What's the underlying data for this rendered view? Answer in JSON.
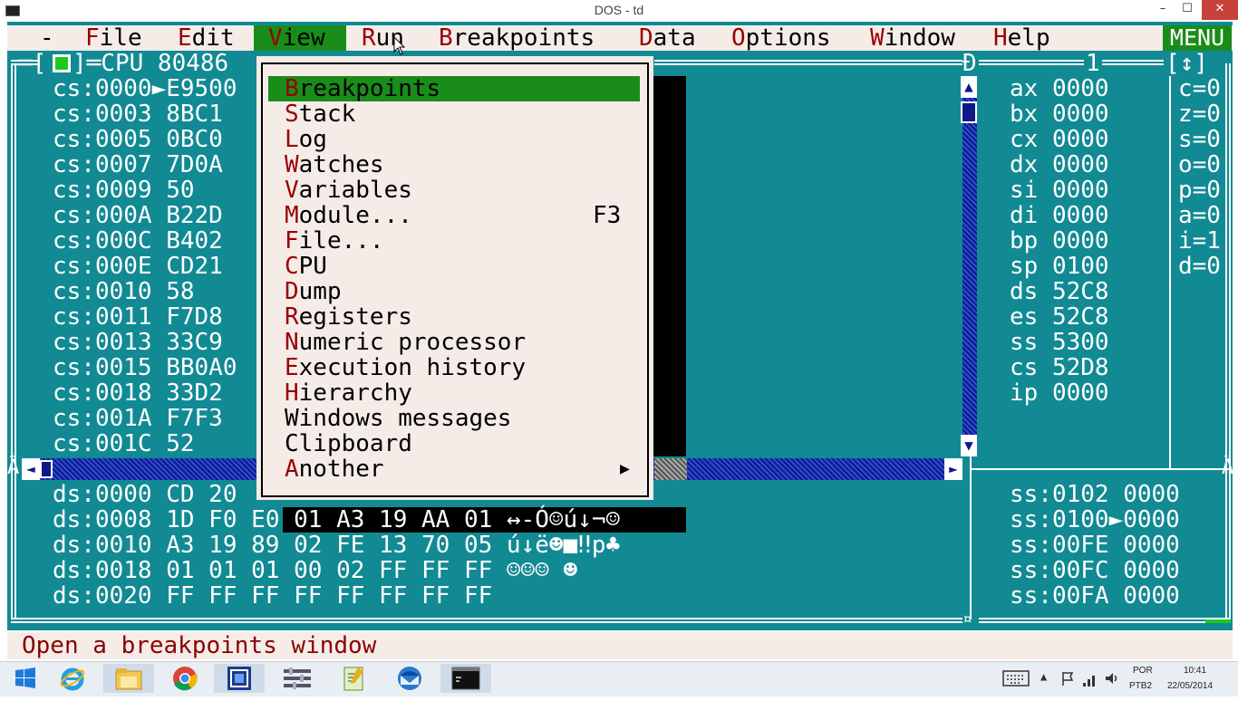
{
  "titlebar": {
    "title": "DOS - td",
    "minimize": "–",
    "maximize": "☐",
    "close": "✕"
  },
  "menubar": {
    "dash": "-",
    "file": {
      "hot": "F",
      "rest": "ile"
    },
    "edit": {
      "hot": "E",
      "rest": "dit"
    },
    "view": {
      "hot": "V",
      "rest": "iew"
    },
    "run": {
      "hot": "R",
      "rest": "un"
    },
    "breakpoints": {
      "hot": "B",
      "rest": "reakpoints"
    },
    "data": {
      "hot": "D",
      "rest": "ata"
    },
    "options": {
      "hot": "O",
      "rest": "ptions"
    },
    "window": {
      "hot": "W",
      "rest": "indow"
    },
    "help": {
      "hot": "H",
      "rest": "elp"
    },
    "menu_button": "MENU"
  },
  "cpu_window": {
    "title_left": "═[",
    "title_box": "■",
    "title_right": "]═CPU 80486",
    "corner_right": "Đ",
    "window_number": "1",
    "resize_box": "[↕]",
    "code_lines": [
      "cs:0000►E9500",
      "cs:0003 8BC1",
      "cs:0005 0BC0",
      "cs:0007 7D0A",
      "cs:0009 50",
      "cs:000A B22D",
      "cs:000C B402",
      "cs:000E CD21",
      "cs:0010 58",
      "cs:0011 F7D8",
      "cs:0013 33C9",
      "cs:0015 BB0A0",
      "cs:0018 33D2",
      "cs:001A F7F3",
      "cs:001C 52"
    ],
    "registers": [
      "ax 0000",
      "bx 0000",
      "cx 0000",
      "dx 0000",
      "si 0000",
      "di 0000",
      "bp 0000",
      "sp 0100",
      "ds 52C8",
      "es 52C8",
      "ss 5300",
      "cs 52D8",
      "ip 0000"
    ],
    "flags": [
      "c=0",
      "z=0",
      "s=0",
      "o=0",
      "p=0",
      "a=0",
      "i=1",
      "d=0"
    ],
    "dump_lines": [
      {
        "left": "ds:0000 CD 20",
        "right": ""
      },
      {
        "left": "ds:0008 1D F0 E",
        "black": "0 01 A3 19 AA 01 ↔-Ó☺ú↓¬☺"
      },
      {
        "left": "ds:0010 A3 19 89 02 FE 13 70 05 ú↓ë☻■‼p♣",
        "black": ""
      },
      {
        "left": "ds:0018 01 01 01 00 02 FF FF FF ☺☺☺ ☻",
        "black": ""
      },
      {
        "left": "ds:0020 FF FF FF FF FF FF FF FF",
        "black": ""
      }
    ],
    "stack_lines": [
      "ss:0102 0000",
      "ss:0100►0000",
      "ss:00FE 0000",
      "ss:00FC 0000",
      "ss:00FA 0000"
    ],
    "scroll_up": "▲",
    "scroll_down": "▼",
    "scroll_left": "◄",
    "scroll_right": "►",
    "edge_left": "Ã",
    "edge_right": "Ä",
    "bottom_corner": "¤"
  },
  "view_menu": {
    "items": [
      {
        "hot": "B",
        "rest": "reakpoints",
        "shortcut": ""
      },
      {
        "hot": "S",
        "rest": "tack",
        "shortcut": ""
      },
      {
        "hot": "L",
        "rest": "og",
        "shortcut": ""
      },
      {
        "hot": "W",
        "rest": "atches",
        "shortcut": ""
      },
      {
        "hot": "V",
        "rest": "ariables",
        "shortcut": ""
      },
      {
        "hot": "M",
        "rest": "odule...",
        "shortcut": "F3"
      },
      {
        "hot": "F",
        "rest": "ile...",
        "shortcut": ""
      },
      {
        "hot": "C",
        "rest": "PU",
        "shortcut": ""
      },
      {
        "hot": "D",
        "rest": "ump",
        "shortcut": ""
      },
      {
        "hot": "R",
        "rest": "egisters",
        "shortcut": ""
      },
      {
        "hot": "N",
        "rest": "umeric processor",
        "shortcut": ""
      },
      {
        "hot": "E",
        "rest": "xecution history",
        "shortcut": ""
      },
      {
        "hot": "H",
        "rest": "ierarchy",
        "shortcut": ""
      },
      {
        "hot": "",
        "rest": "Windows messages",
        "shortcut": ""
      },
      {
        "hot": "",
        "rest": "Clipboard",
        "shortcut": ""
      },
      {
        "hot": "A",
        "rest": "nother",
        "shortcut": "▶"
      }
    ]
  },
  "status": {
    "text": "Open a breakpoints window"
  },
  "taskbar": {
    "apps": [
      "start-icon",
      "ie-icon",
      "explorer-icon",
      "chrome-icon",
      "app-icon",
      "tools-icon",
      "notepad-icon",
      "thunderbird-icon",
      "cmd-icon"
    ],
    "lang": "POR",
    "layout": "PTB2",
    "time": "10:41",
    "date": "22/05/2014"
  }
}
